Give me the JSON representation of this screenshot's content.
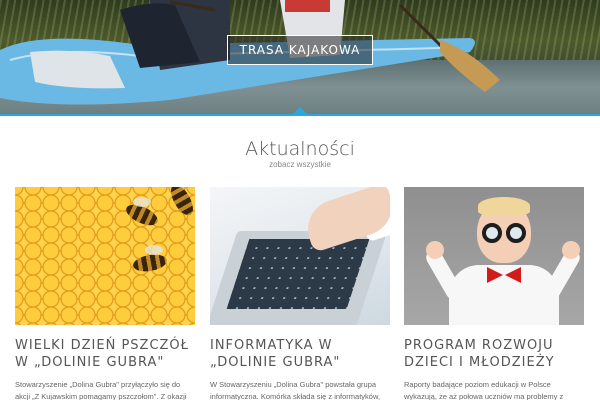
{
  "hero": {
    "button_label": "TRASA KAJAKOWA"
  },
  "section": {
    "title": "Aktualności",
    "link": "zobacz wszystkie"
  },
  "cards": [
    {
      "image": "honeycomb-bees",
      "title": "WIELKI DZIEŃ PSZCZÓŁ W „DOLINIE GUBRA\"",
      "excerpt": "Stowarzyszenie „Dolina Gubra\" przyłączyło się do akcji „Z Kujawskim pomagamy pszczołom\". Z okazji"
    },
    {
      "image": "laptop-hand",
      "title": "INFORMATYKA W „DOLINIE GUBRA\"",
      "excerpt": "W Stowarzyszeniu „Dolina Gubra\" powstała grupa informatyczna. Komórka składa się z informatyków,"
    },
    {
      "image": "boy-glasses",
      "title": "PROGRAM ROZWOJU DZIECI I MŁODZIEŻY",
      "excerpt": "Raporty badające poziom edukacji w Polsce wykazują, że aż połowa uczniów ma problemy z"
    }
  ],
  "colors": {
    "accent": "#29a8e0",
    "bowtie": "#d21c1c",
    "honey": "#ffd34d"
  }
}
